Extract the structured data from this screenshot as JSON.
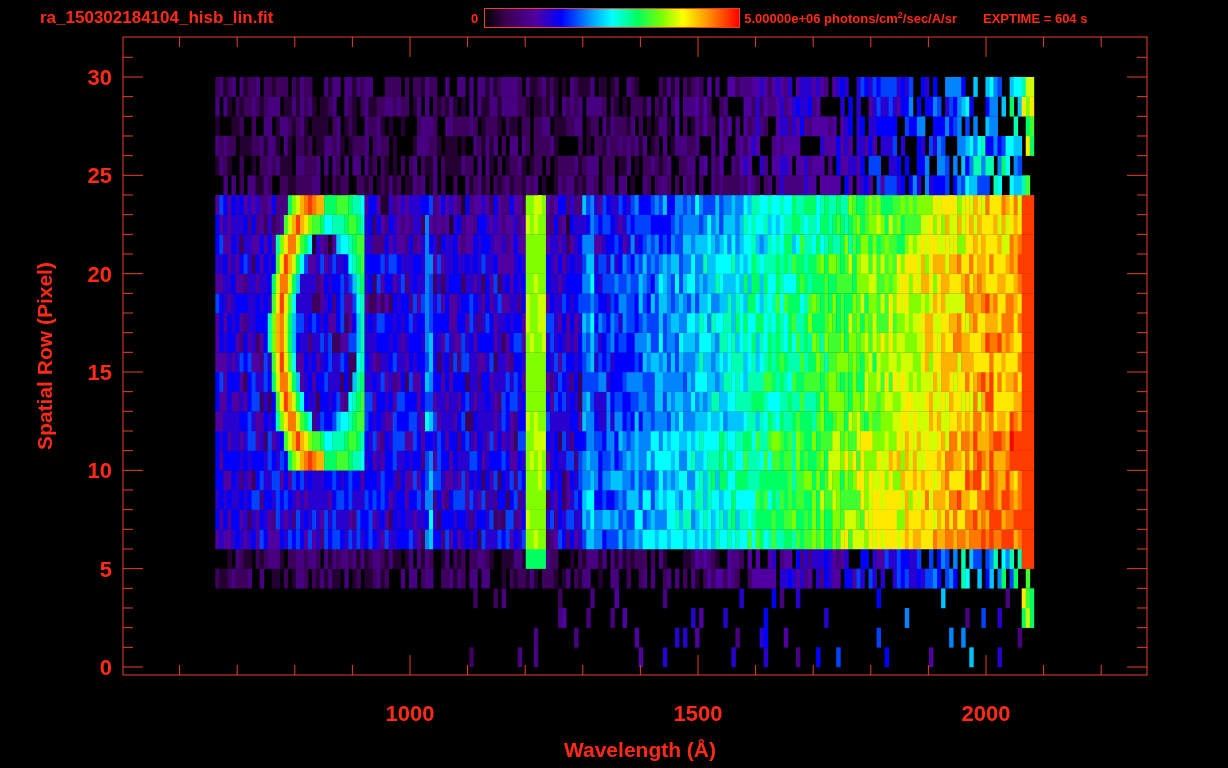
{
  "header": {
    "filename": "ra_150302184104_hisb_lin.fit",
    "colorbar": {
      "min_label": "0",
      "max_label": "5.00000e+06 photons/cm$^{2}$/sec/A/sr"
    },
    "exposure": "EXPTIME = 604 s"
  },
  "plot": {
    "xlabel": "Wavelength (Å)",
    "ylabel": "Spatial Row (Pixel)",
    "xtick_labels": [
      "1000",
      "1500",
      "2000"
    ],
    "ytick_labels": [
      "30",
      "25",
      "20",
      "15",
      "10",
      "5",
      "0"
    ]
  }
}
